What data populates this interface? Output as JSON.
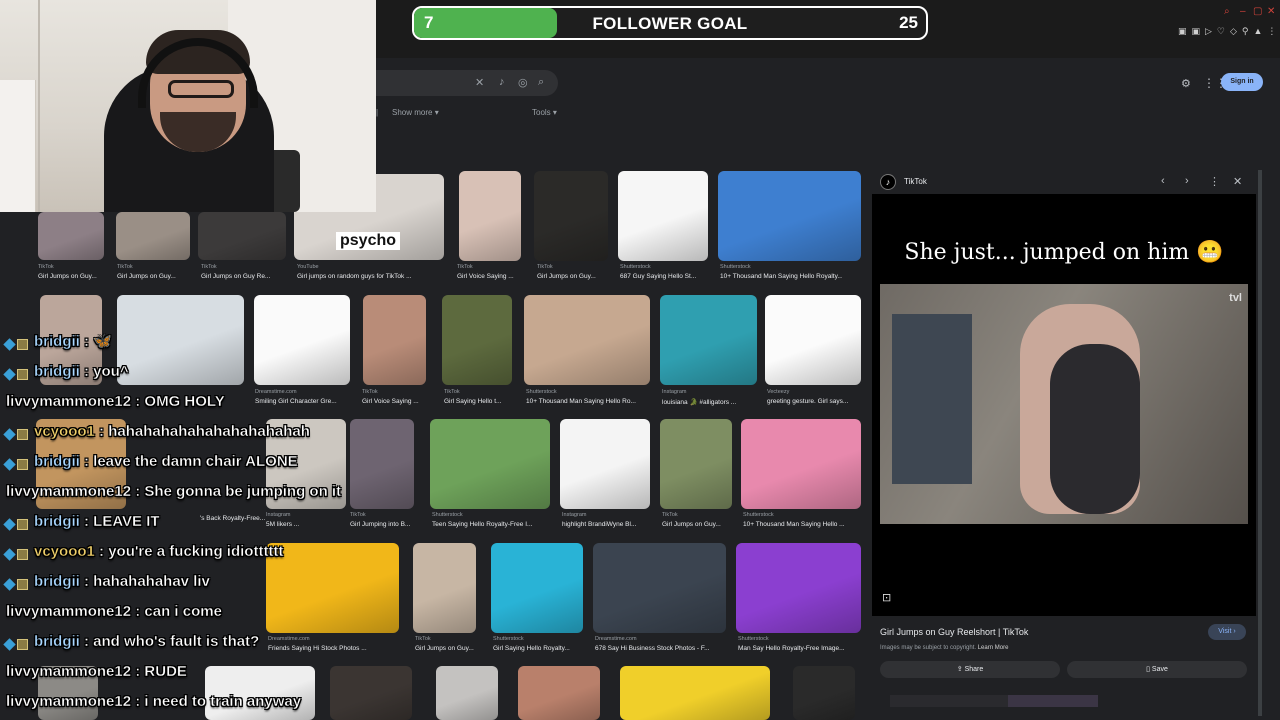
{
  "goal": {
    "current": "7",
    "title": "FOLLOWER GOAL",
    "target": "25",
    "progress_fraction": 0.28
  },
  "search": {
    "filter_show_more": "Show more",
    "filter_tools": "Tools",
    "sign_in": "Sign in"
  },
  "grid": {
    "overlay_text": "psycho",
    "captions": [
      {
        "src": "TikTok",
        "title": "Girl Jumps on Guy..."
      },
      {
        "src": "TikTok",
        "title": "Girl Jumps on Guy..."
      },
      {
        "src": "TikTok",
        "title": "Girl Jumps on Guy Re..."
      },
      {
        "src": "YouTube",
        "title": "Girl jumps on random guys for TikTok ..."
      },
      {
        "src": "TikTok",
        "title": "Girl Voice Saying ..."
      },
      {
        "src": "TikTok",
        "title": "Girl Jumps on Guy..."
      },
      {
        "src": "Shutterstock",
        "title": "687 Guy Saying Hello St..."
      },
      {
        "src": "Shutterstock",
        "title": "10+ Thousand Man Saying Hello Royalty..."
      },
      {
        "src": "Dreamstime.com",
        "title": "Smiling Girl Character Gre..."
      },
      {
        "src": "TikTok",
        "title": "Girl Voice Saying ..."
      },
      {
        "src": "TikTok",
        "title": "Girl Saying Hello t..."
      },
      {
        "src": "Shutterstock",
        "title": "10+ Thousand Man Saying Hello Ro..."
      },
      {
        "src": "Instagram",
        "title": "louisiana 🐊 #alligators ..."
      },
      {
        "src": "Vecteezy",
        "title": "greeting gesture. Girl says..."
      },
      {
        "src": "",
        "title": "'s Back Royalty-Free..."
      },
      {
        "src": "Instagram",
        "title": "5M likers ..."
      },
      {
        "src": "TikTok",
        "title": "Girl Jumping into B..."
      },
      {
        "src": "Shutterstock",
        "title": "Teen Saying Hello Royalty-Free I..."
      },
      {
        "src": "Instagram",
        "title": "highlight BrandiWyne Bl..."
      },
      {
        "src": "TikTok",
        "title": "Girl Jumps on Guy..."
      },
      {
        "src": "Shutterstock",
        "title": "10+ Thousand Man Saying Hello ..."
      },
      {
        "src": "Dreamstime.com",
        "title": "Friends Saying Hi Stock Photos ..."
      },
      {
        "src": "TikTok",
        "title": "Girl Jumps on Guy..."
      },
      {
        "src": "Shutterstock",
        "title": "Girl Saying Hello Royalty..."
      },
      {
        "src": "Dreamstime.com",
        "title": "678 Say Hi Business Stock Photos - F..."
      },
      {
        "src": "Shutterstock",
        "title": "Man Say Hello Royalty-Free Image..."
      }
    ]
  },
  "panel": {
    "source": "TikTok",
    "caption": "She just... jumped on him 😬",
    "watermark": "tvl",
    "title": "Girl Jumps on Guy Reelshort | TikTok",
    "visit": "Visit",
    "copyright": "Images may be subject to copyright.",
    "learn_more": "Learn More",
    "share": "Share",
    "save": "Save"
  },
  "chat": [
    {
      "user": "bridgii",
      "text": ": 🦋",
      "color": "b"
    },
    {
      "user": "bridgii",
      "text": ": you^",
      "color": "b"
    },
    {
      "user": "livvymammone12",
      "text": ": OMG HOLY",
      "color": "l"
    },
    {
      "user": "vcyooo1",
      "text": ": hahahahahahahahahahahah",
      "color": "v"
    },
    {
      "user": "bridgii",
      "text": ": leave the damn chair ALONE",
      "color": "b"
    },
    {
      "user": "livvymammone12",
      "text": ": She gonna be jumping on it",
      "color": "l"
    },
    {
      "user": "bridgii",
      "text": ": LEAVE IT",
      "color": "b"
    },
    {
      "user": "vcyooo1",
      "text": ": you're a fucking idiotttttt",
      "color": "v"
    },
    {
      "user": "bridgii",
      "text": ": hahahahahav liv",
      "color": "b"
    },
    {
      "user": "livvymammone12",
      "text": ": can i come",
      "color": "l"
    },
    {
      "user": "bridgii",
      "text": ": and who's fault is that?",
      "color": "b"
    },
    {
      "user": "livvymammone12",
      "text": ": RUDE",
      "color": "l"
    },
    {
      "user": "livvymammone12",
      "text": ": i need to train anyway",
      "color": "l"
    }
  ],
  "colors": {
    "goal_fill": "#4fb24f",
    "accent_blue": "#8ab4f8",
    "chat_user_blue": "#a9d7ff",
    "chat_user_gold": "#f0d06a"
  }
}
